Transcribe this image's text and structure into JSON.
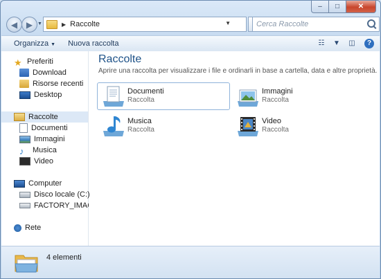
{
  "window": {
    "caption_buttons": {
      "minimize": "–",
      "maximize": "□",
      "close": "✕"
    }
  },
  "navbar": {
    "breadcrumb": "Raccolte",
    "search_placeholder": "Cerca Raccolte"
  },
  "toolbar": {
    "organize_label": "Organizza",
    "new_collection_label": "Nuova raccolta"
  },
  "sidebar": {
    "favorites": {
      "label": "Preferiti",
      "items": [
        {
          "label": "Download",
          "icon": "download-folder-icon"
        },
        {
          "label": "Risorse recenti",
          "icon": "recent-places-icon"
        },
        {
          "label": "Desktop",
          "icon": "desktop-icon"
        }
      ]
    },
    "libraries": {
      "label": "Raccolte",
      "items": [
        {
          "label": "Documenti"
        },
        {
          "label": "Immagini"
        },
        {
          "label": "Musica"
        },
        {
          "label": "Video"
        }
      ]
    },
    "computer": {
      "label": "Computer",
      "items": [
        {
          "label": "Disco locale (C:)"
        },
        {
          "label": "FACTORY_IMAGE (D"
        }
      ]
    },
    "network": {
      "label": "Rete"
    }
  },
  "main": {
    "title": "Raccolte",
    "description": "Aprire una raccolta per visualizzare i file e ordinarli in base a cartella, data e altre proprietà.",
    "libraries": [
      {
        "name": "Documenti",
        "type": "Raccolta",
        "icon": "documents-library-icon"
      },
      {
        "name": "Immagini",
        "type": "Raccolta",
        "icon": "pictures-library-icon"
      },
      {
        "name": "Musica",
        "type": "Raccolta",
        "icon": "music-library-icon"
      },
      {
        "name": "Video",
        "type": "Raccolta",
        "icon": "video-library-icon"
      }
    ]
  },
  "status": {
    "count_text": "4 elementi"
  },
  "colors": {
    "title_blue": "#1e5288",
    "selection": "#dce8f6"
  }
}
